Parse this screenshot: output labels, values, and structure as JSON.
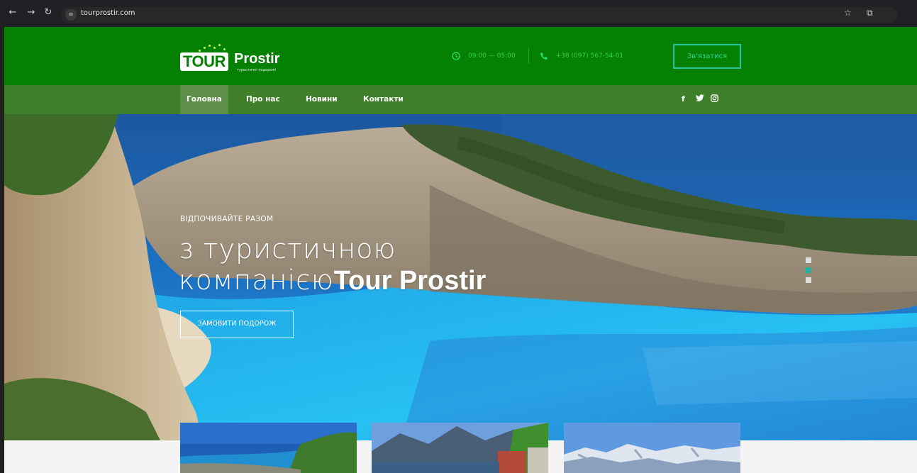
{
  "browser": {
    "url": "tourprostir.com",
    "back_icon": "arrow-left-icon",
    "forward_icon": "arrow-right-icon",
    "reload_icon": "reload-icon",
    "site_info_icon": "tune-icon",
    "bookmark_icon": "star-icon",
    "extensions_icon": "puzzle-icon"
  },
  "header": {
    "logo_word1": "TOUR",
    "logo_word2": "Prostir",
    "logo_tagline": "туристичні подорожі",
    "hours": "09:00 — 05:00",
    "phone": "+38 (097) 567-54-01",
    "cta_label": "Зв'язатися",
    "brand_color": "#048003",
    "accent_color": "#27c3a6"
  },
  "nav": {
    "items": [
      {
        "label": "Головна",
        "active": true
      },
      {
        "label": "Про нас",
        "active": false
      },
      {
        "label": "Новини",
        "active": false
      },
      {
        "label": "Контакти",
        "active": false
      }
    ],
    "social": [
      "facebook-icon",
      "twitter-icon",
      "instagram-icon"
    ]
  },
  "hero": {
    "eyebrow": "ВІДПОЧИВАЙТЕ РАЗОМ",
    "title_line1": "з туристичною",
    "title_line2_light": "компанією",
    "title_line2_bold": "Tour Prostir",
    "button_label": "ЗАМОВИТИ ПОДОРОЖ",
    "slides_count": 3,
    "active_slide": 2
  },
  "cards": [
    {
      "name": "tour-card-coast"
    },
    {
      "name": "tour-card-mountain-village"
    },
    {
      "name": "tour-card-snow-mountains"
    }
  ]
}
